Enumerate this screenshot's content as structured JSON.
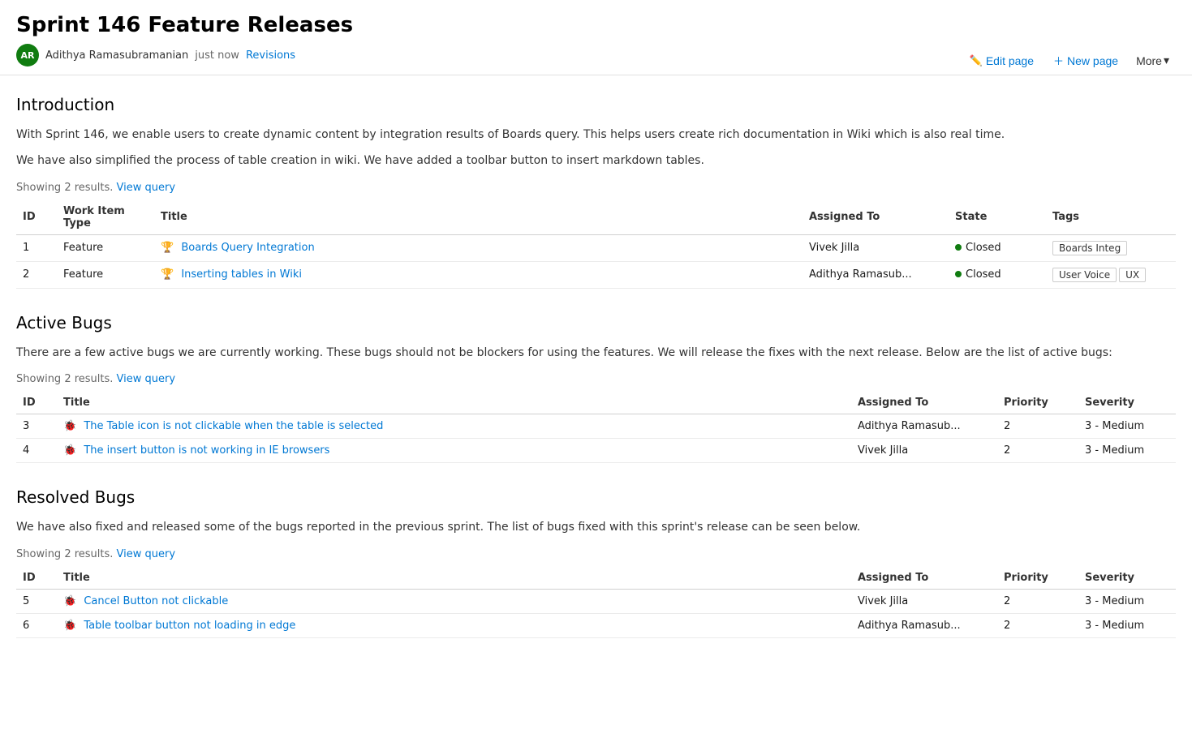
{
  "header": {
    "title": "Sprint 146 Feature Releases",
    "author": {
      "initials": "AR",
      "name": "Adithya Ramasubramanian",
      "avatarColor": "#107c10"
    },
    "timestamp": "just now",
    "revisions_label": "Revisions"
  },
  "actions": {
    "edit_label": "Edit page",
    "new_label": "New page",
    "more_label": "More"
  },
  "introduction": {
    "section_title": "Introduction",
    "paragraphs": [
      "With Sprint 146, we enable users to create dynamic content by integration results of Boards query. This helps users create rich documentation in Wiki which is also real time.",
      "We have also simplified the process of table creation in wiki. We have added a toolbar button to insert markdown tables."
    ],
    "query_info": "Showing 2 results.",
    "view_query_label": "View query",
    "table": {
      "columns": [
        "ID",
        "Work Item Type",
        "Title",
        "Assigned To",
        "State",
        "Tags"
      ],
      "rows": [
        {
          "id": "1",
          "type": "Feature",
          "title": "Boards Query Integration",
          "assigned_to": "Vivek Jilla",
          "state": "Closed",
          "tags": [
            "Boards Integ"
          ]
        },
        {
          "id": "2",
          "type": "Feature",
          "title": "Inserting tables in Wiki",
          "assigned_to": "Adithya Ramasub...",
          "state": "Closed",
          "tags": [
            "User Voice",
            "UX"
          ]
        }
      ]
    }
  },
  "active_bugs": {
    "section_title": "Active Bugs",
    "paragraph": "There are a few active bugs we are currently working. These bugs should not be blockers for using the features. We will release the fixes with the next release. Below are the list of active bugs:",
    "query_info": "Showing 2 results.",
    "view_query_label": "View query",
    "table": {
      "columns": [
        "ID",
        "Title",
        "Assigned To",
        "Priority",
        "Severity"
      ],
      "rows": [
        {
          "id": "3",
          "title": "The Table icon is not clickable when the table is selected",
          "assigned_to": "Adithya Ramasub...",
          "priority": "2",
          "severity": "3 - Medium"
        },
        {
          "id": "4",
          "title": "The insert button is not working in IE browsers",
          "assigned_to": "Vivek Jilla",
          "priority": "2",
          "severity": "3 - Medium"
        }
      ]
    }
  },
  "resolved_bugs": {
    "section_title": "Resolved Bugs",
    "paragraph": "We have also fixed and released some of the bugs reported in the previous sprint. The list of bugs fixed with this sprint's release can be seen below.",
    "query_info": "Showing 2 results.",
    "view_query_label": "View query",
    "table": {
      "columns": [
        "ID",
        "Title",
        "Assigned To",
        "Priority",
        "Severity"
      ],
      "rows": [
        {
          "id": "5",
          "title": "Cancel Button not clickable",
          "assigned_to": "Vivek Jilla",
          "priority": "2",
          "severity": "3 - Medium"
        },
        {
          "id": "6",
          "title": "Table toolbar button not loading in edge",
          "assigned_to": "Adithya Ramasub...",
          "priority": "2",
          "severity": "3 - Medium"
        }
      ]
    }
  }
}
